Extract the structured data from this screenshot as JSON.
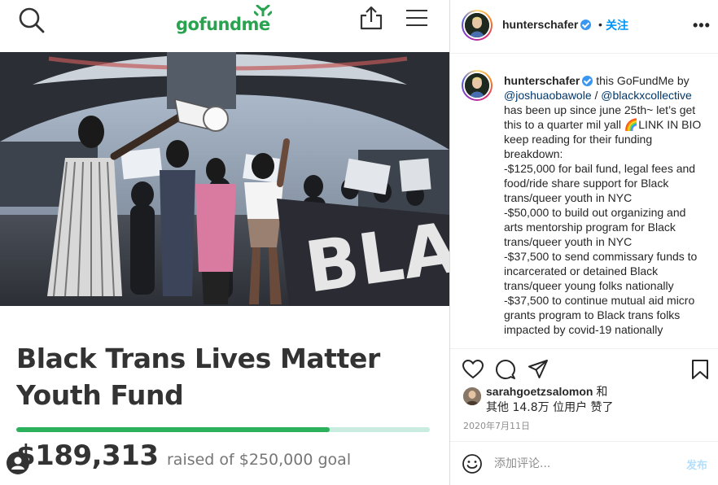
{
  "gofundme": {
    "logo_text": "gofundme",
    "icons": [
      "search-icon",
      "share-icon",
      "menu-icon",
      "user-icon"
    ],
    "photo_banner_text": "BLACK",
    "campaign_title": "Black Trans Lives Matter Youth Fund",
    "amount_raised": "$189,313",
    "goal_prefix": "raised of",
    "goal_amount": "$250,000",
    "goal_suffix": "goal",
    "progress_fraction": 0.757,
    "colors": {
      "brand_green": "#29a34f",
      "progress_fill": "#2bb05b",
      "progress_track": "#c9ece0"
    }
  },
  "instagram": {
    "header": {
      "username": "hunterschafer",
      "dot": "•",
      "follow_label": "关注",
      "more_label": "•••"
    },
    "caption": {
      "username": "hunterschafer",
      "intro": "this GoFundMe by",
      "mention_1": "@joshuaobawole",
      "separator": " / ",
      "mention_2": "@blackxcollective",
      "lines": [
        "has been up since june 25th~ let’s get",
        "this to a quarter mil yall 🌈LINK IN BIO",
        "keep reading for their funding",
        "breakdown:",
        "-$125,000 for bail fund, legal fees and",
        "food/ride share support for Black",
        "trans/queer youth in NYC",
        "-$50,000 to build out organizing and",
        "arts mentorship program for Black",
        "trans/queer youth in NYC",
        "-$37,500 to send commissary funds to",
        "incarcerated or detained Black",
        "trans/queer young folks nationally",
        "-$37,500 to continue mutual aid micro",
        "grants program to Black trans folks",
        "impacted by covid-19 nationally"
      ]
    },
    "actions": {
      "icons": [
        "heart-icon",
        "comment-icon",
        "send-icon",
        "bookmark-icon"
      ]
    },
    "likes": {
      "liker": "sarahgoetzsalomon",
      "and_text": "和",
      "others_text": "其他 14.8万 位用户 赞了"
    },
    "date": "2020年7月11日",
    "comment": {
      "placeholder": "添加评论...",
      "post_label": "发布"
    },
    "colors": {
      "link_blue": "#0095f6",
      "verified_blue": "#3897f0",
      "mention": "#00376b",
      "muted": "#8e8e8e"
    }
  }
}
